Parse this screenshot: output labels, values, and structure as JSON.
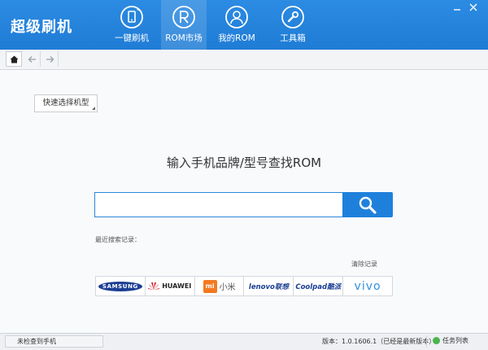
{
  "app": {
    "title": "超级刷机"
  },
  "nav": {
    "tabs": [
      {
        "label": "一键刷机",
        "icon": "phone-refresh-icon"
      },
      {
        "label": "ROM市场",
        "icon": "rom-market-icon",
        "active": true
      },
      {
        "label": "我的ROM",
        "icon": "user-icon"
      },
      {
        "label": "工具箱",
        "icon": "wrench-icon"
      }
    ]
  },
  "toolbar": {
    "home_icon": "home-icon",
    "back_icon": "back-arrow-icon",
    "forward_icon": "forward-arrow-icon"
  },
  "main": {
    "quick_select_label": "快速选择机型",
    "search_title": "输入手机品牌/型号查找ROM",
    "search": {
      "value": "",
      "placeholder": ""
    },
    "recent_label": "最近搜索记录：",
    "clear_label": "清除记录",
    "brands": [
      {
        "name": "SAMSUNG"
      },
      {
        "name": "HUAWEI"
      },
      {
        "name": "小米",
        "badge": "mi"
      },
      {
        "name": "lenovo联想"
      },
      {
        "name": "Coolpad酷派"
      },
      {
        "name": "vivo"
      }
    ]
  },
  "status": {
    "device_status": "未检查到手机",
    "version": "版本：1.0.1606.1（已经是最新版本）",
    "tasks_label": "任务列表"
  },
  "colors": {
    "brand_blue": "#1f80dc",
    "titlebar_top": "#2c8be2",
    "samsung_blue": "#1c3f94",
    "mi_orange": "#f47a20",
    "vivo_blue": "#2f8fe0",
    "task_green": "#49b44b"
  }
}
